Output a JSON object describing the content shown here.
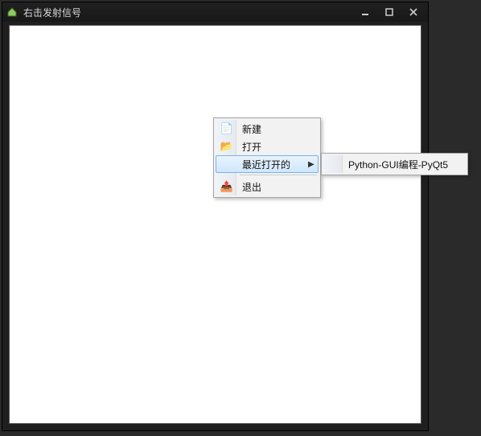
{
  "window": {
    "title": "右击发射信号"
  },
  "context_menu": {
    "items": [
      {
        "label": "新建",
        "icon": "📄"
      },
      {
        "label": "打开",
        "icon": "📂"
      },
      {
        "label": "最近打开的",
        "icon": "",
        "has_submenu": true,
        "highlight": true
      },
      {
        "label": "退出",
        "icon": "📤"
      }
    ]
  },
  "submenu": {
    "items": [
      {
        "label": "Python-GUI编程-PyQt5"
      }
    ]
  }
}
